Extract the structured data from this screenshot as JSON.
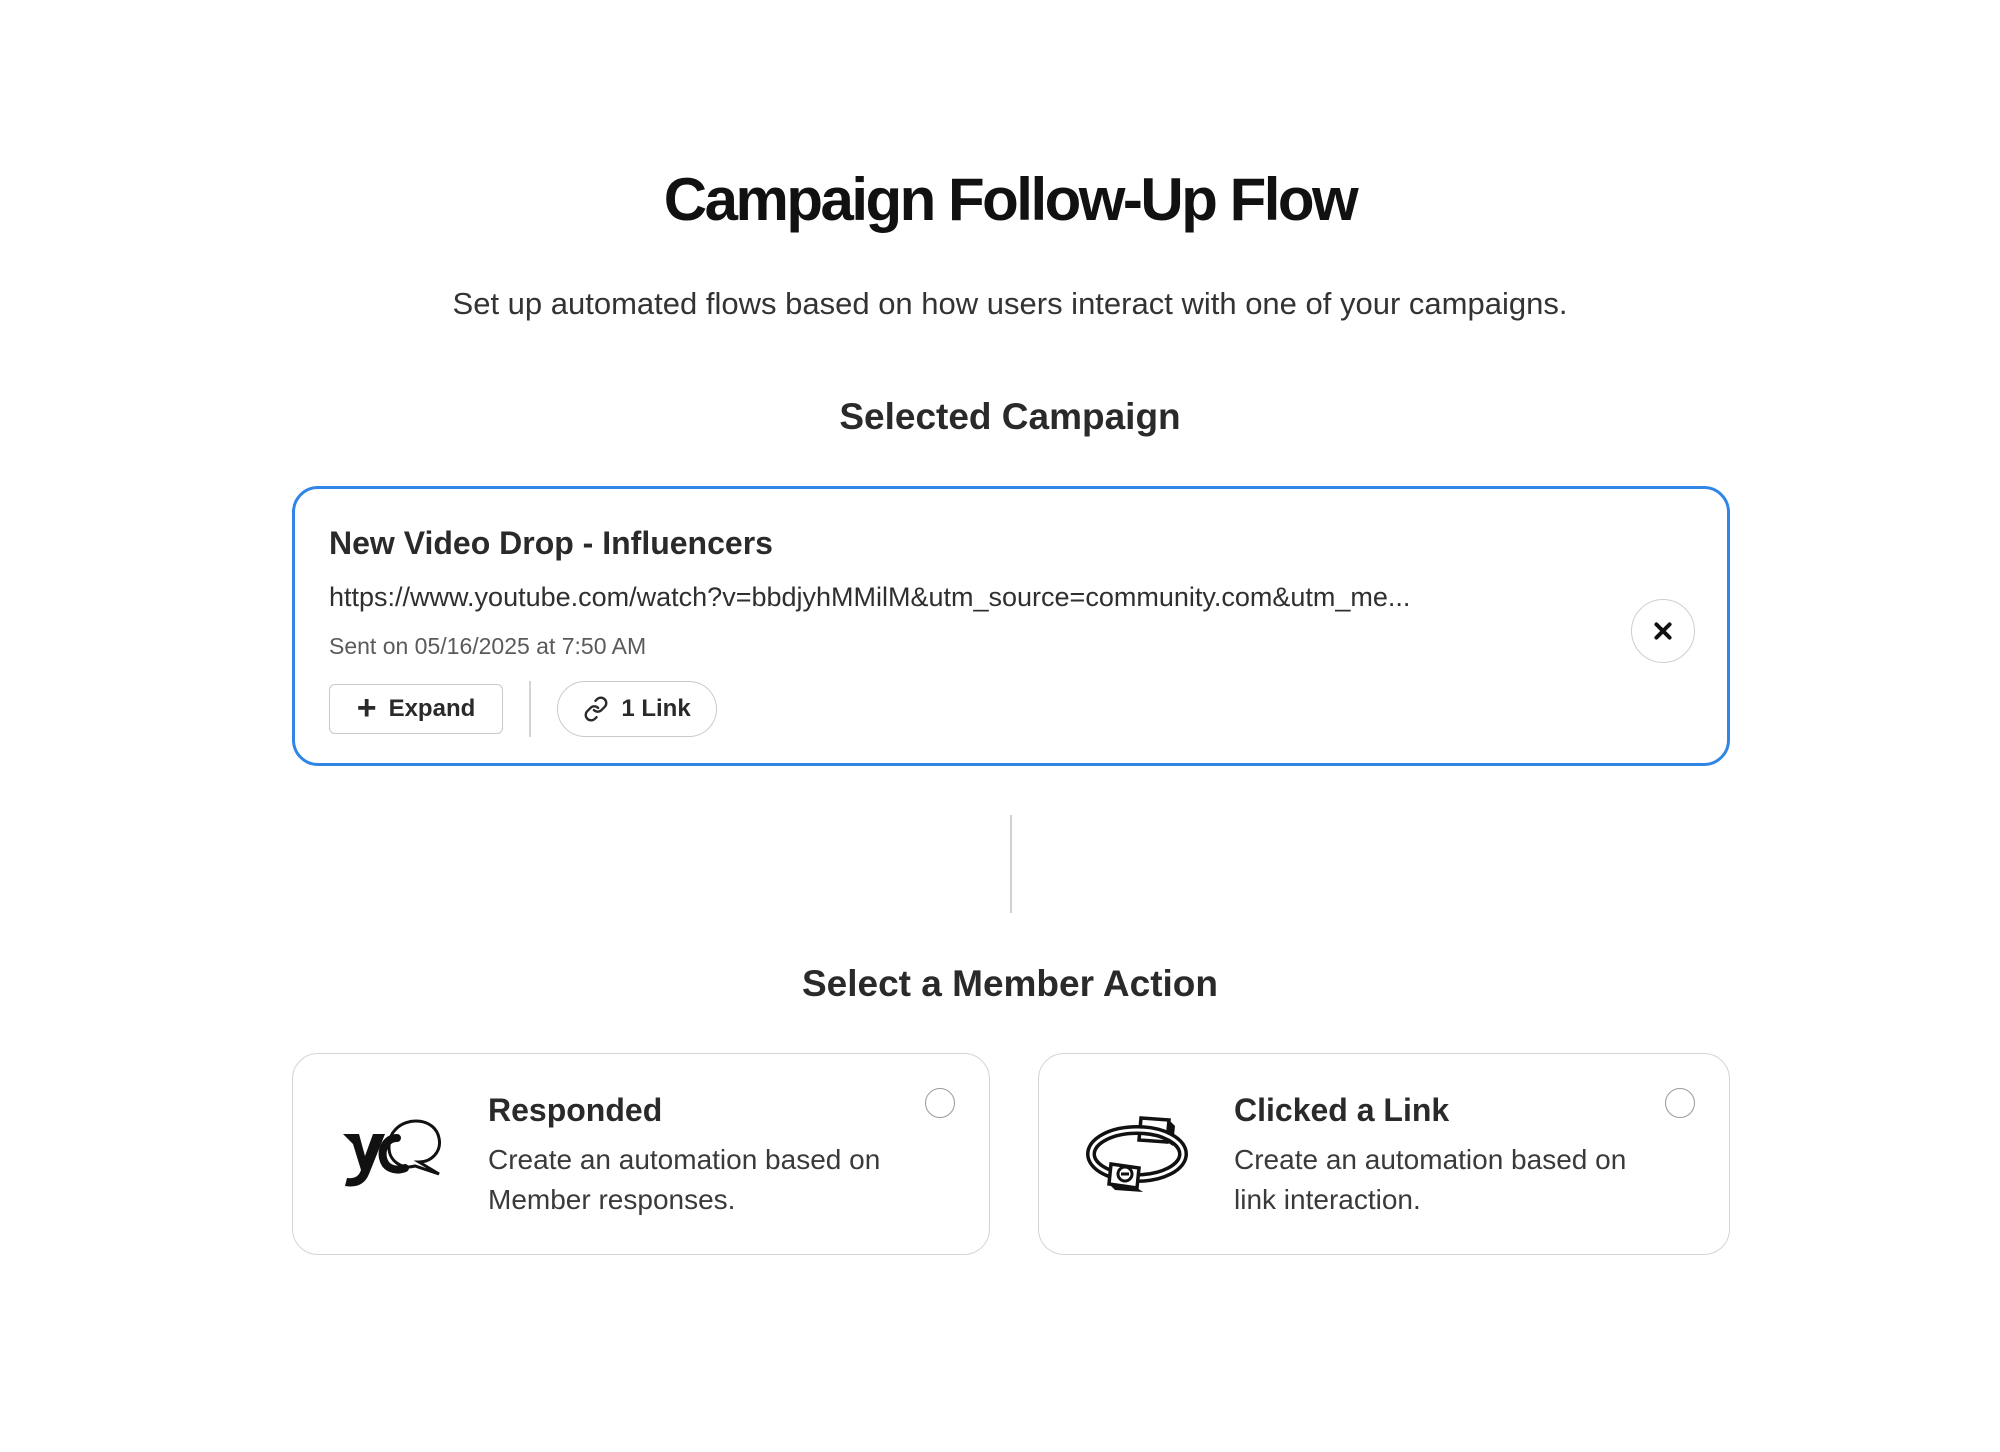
{
  "header": {
    "title": "Campaign Follow-Up Flow",
    "subtitle": "Set up automated flows based on how users interact with one of your campaigns."
  },
  "selected_campaign": {
    "heading": "Selected Campaign",
    "name": "New Video Drop - Influencers",
    "url": "https://www.youtube.com/watch?v=bbdjyhMMilM&utm_source=community.com&utm_me...",
    "sent": "Sent on 05/16/2025 at 7:50 AM",
    "expand_label": "Expand",
    "links_label": "1 Link",
    "accent_color": "#2f86e6",
    "icons": {
      "expand": "plus-icon",
      "links": "link-icon",
      "remove": "close-icon"
    }
  },
  "member_action": {
    "heading": "Select a Member Action",
    "options": [
      {
        "title": "Responded",
        "description": "Create an automation based on Member responses.",
        "icon": "speech-bubble-illustration",
        "selected": false
      },
      {
        "title": "Clicked a Link",
        "description": "Create an automation based on link interaction.",
        "icon": "chain-link-illustration",
        "selected": false
      }
    ]
  }
}
